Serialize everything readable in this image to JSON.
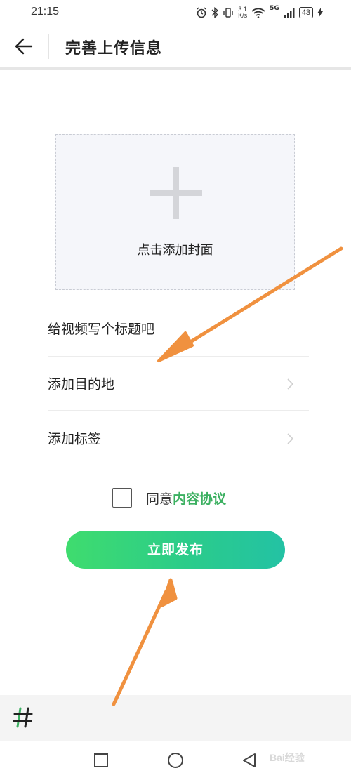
{
  "status_bar": {
    "time": "21:15",
    "net_speed_value": "3.1",
    "net_speed_unit": "K/s",
    "signal_label": "5G",
    "battery": "43",
    "icons": [
      "alarm-icon",
      "bluetooth-icon",
      "vibrate-icon",
      "wifi-icon",
      "signal-icon",
      "charging-icon"
    ]
  },
  "header": {
    "back_icon": "arrow-left-icon",
    "title": "完善上传信息"
  },
  "cover": {
    "icon": "plus-icon",
    "label": "点击添加封面"
  },
  "form": {
    "title_placeholder": "给视频写个标题吧",
    "destination_label": "添加目的地",
    "tags_label": "添加标签"
  },
  "agreement": {
    "checked": false,
    "prefix": "同意",
    "link": "内容协议",
    "link_color": "#3cb061"
  },
  "publish": {
    "label": "立即发布",
    "gradient_start": "#3fdc6e",
    "gradient_end": "#23c2a4"
  },
  "bottom_bar": {
    "icon": "hashtag-icon"
  },
  "nav": {
    "icons": [
      "recent-apps-icon",
      "home-icon",
      "back-triangle-icon"
    ]
  },
  "watermark": "Bai经验",
  "annotation_color": "#f0913f"
}
